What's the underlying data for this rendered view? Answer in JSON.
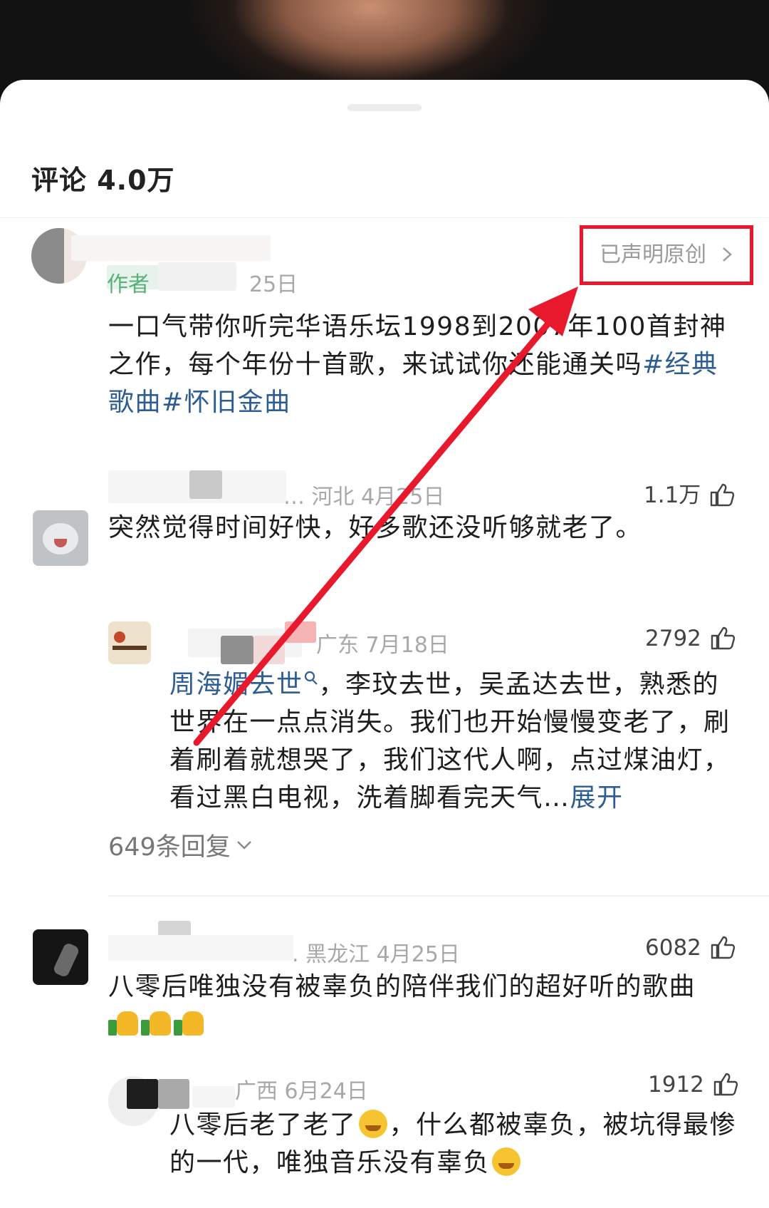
{
  "header": {
    "title": "评论 4.0万"
  },
  "author_post": {
    "badge": "作者",
    "date_fragment": "25日",
    "original_label": "已声明原创",
    "text_plain": "一口气带你听完华语乐坛1998到2007年100首封神之作，每个年份十首歌，来试试你还能通关吗",
    "hashtag1": "#经典歌曲",
    "hashtag2": "#怀旧金曲"
  },
  "comments": [
    {
      "meta": "… 河北 4月25日",
      "likes": "1.1万",
      "text": "突然觉得时间好快，好多歌还没听够就老了。"
    },
    {
      "meta": "广东 7月18日",
      "likes": "2792",
      "mention": "周海媚去世",
      "text": "，李玟去世，吴孟达去世，熟悉的世界在一点点消失。我们也开始慢慢变老了，刷着刷着就想哭了，我们这代人啊，点过煤油灯，看过黑白电视，洗着脚看完天气…",
      "expand": "展开",
      "replies": "649条回复"
    },
    {
      "meta": ". 黑龙江 4月25日",
      "likes": "6082",
      "text": "八零后唯独没有被辜负的陪伴我们的超好听的歌曲"
    },
    {
      "meta": "广西 6月24日",
      "likes": "1912",
      "text_a": "八零后老了老了",
      "text_b": "，什么都被辜负，被坑得最惨的一代，唯独音乐没有辜负"
    }
  ],
  "icons": [
    "thumbs-up-icon",
    "chevron-right-icon",
    "chevron-down-icon",
    "search-mention-icon",
    "emoji-crying-icon",
    "emoji-thumbs-up-icon"
  ],
  "colors": {
    "accent_link": "#2e5d94",
    "annotation_red": "#e8192c",
    "meta_gray": "#a8a8a8"
  }
}
